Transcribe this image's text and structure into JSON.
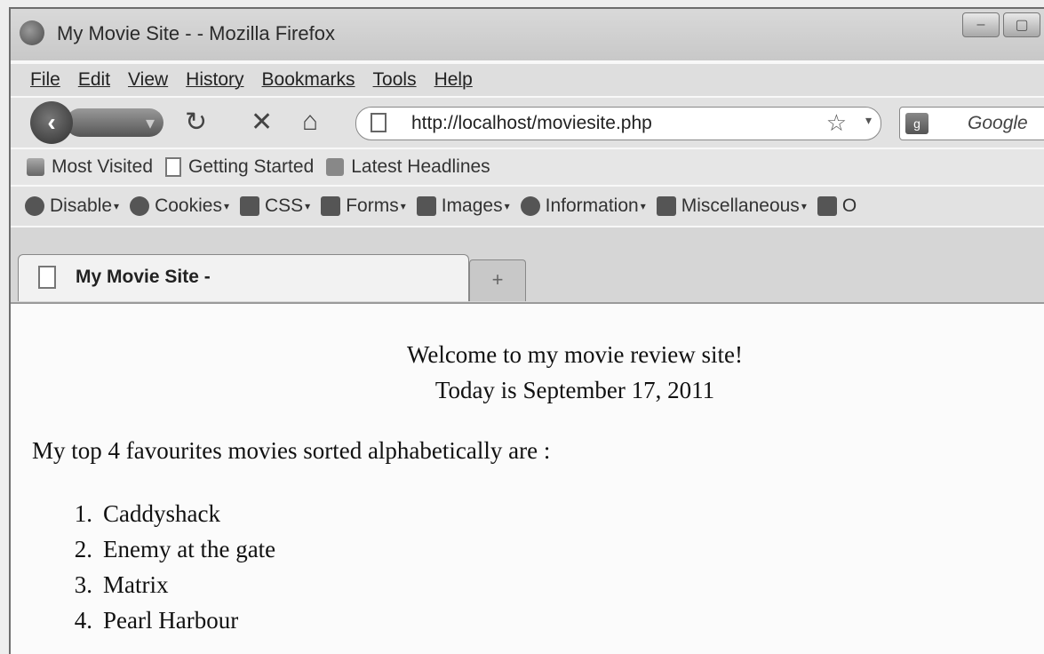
{
  "window": {
    "title": "My Movie Site - - Mozilla Firefox"
  },
  "menu": [
    "File",
    "Edit",
    "View",
    "History",
    "Bookmarks",
    "Tools",
    "Help"
  ],
  "nav": {
    "url": "http://localhost/moviesite.php",
    "search_placeholder": "Google"
  },
  "bookmarks": [
    "Most Visited",
    "Getting Started",
    "Latest Headlines"
  ],
  "webdev": [
    "Disable",
    "Cookies",
    "CSS",
    "Forms",
    "Images",
    "Information",
    "Miscellaneous",
    "O"
  ],
  "tab": {
    "title": "My Movie Site -",
    "new_tab": "+"
  },
  "page": {
    "welcome": "Welcome to my movie review site!",
    "date": "Today is September 17, 2011",
    "intro": "My top 4 favourites movies sorted alphabetically are :",
    "movies": [
      {
        "num": "1.",
        "title": "Caddyshack"
      },
      {
        "num": "2.",
        "title": "Enemy at the gate"
      },
      {
        "num": "3.",
        "title": "Matrix"
      },
      {
        "num": "4.",
        "title": "Pearl Harbour"
      }
    ]
  }
}
